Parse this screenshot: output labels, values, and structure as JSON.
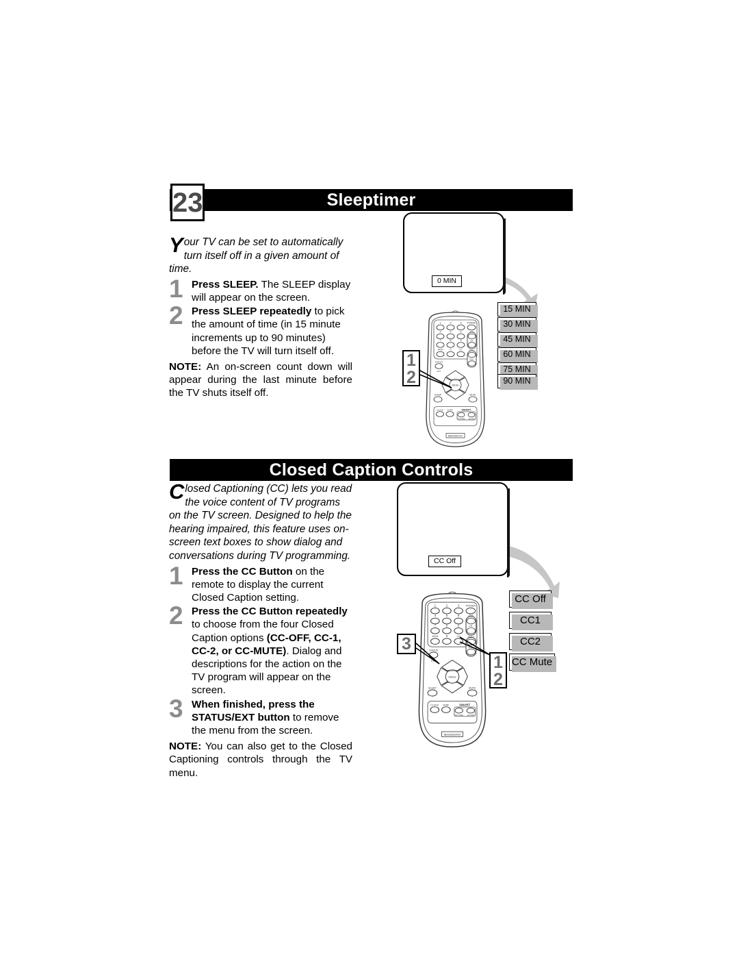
{
  "page": {
    "number": "23"
  },
  "sections": [
    {
      "id": "sleeptimer",
      "title": "Sleeptimer",
      "intro_dropcap": "Y",
      "intro_text": "our TV can be set to automatically turn itself off in a given amount of time.",
      "steps": [
        {
          "num": "1",
          "bold": "Press SLEEP.",
          "rest": " The SLEEP display will appear on the screen."
        },
        {
          "num": "2",
          "bold": "Press SLEEP repeatedly",
          "rest": " to pick the amount of time (in 15 minute increments up to 90 minutes) before the TV will turn itself off."
        }
      ],
      "note_label": "NOTE:",
      "note_text": " An on-screen count down will appear during the last minute before the TV shuts itself off.",
      "tv_osd": "0 MIN",
      "options": [
        "15 MIN",
        "30 MIN",
        "45 MIN",
        "60 MIN",
        "75 MIN",
        "90 MIN"
      ],
      "callout": [
        "1",
        "2"
      ]
    },
    {
      "id": "closed-caption-controls",
      "title": "Closed Caption Controls",
      "intro_dropcap": "C",
      "intro_text": "losed Captioning (CC) lets you read the voice content of TV programs on the TV screen. Designed to help the hearing impaired, this feature uses on-screen text boxes to show dialog and conversations during TV programming.",
      "steps": [
        {
          "num": "1",
          "bold": "Press the CC Button",
          "rest": " on the remote to display the current Closed Caption setting."
        },
        {
          "num": "2",
          "bold": "Press the CC Button repeatedly",
          "mid": " to choose from the four Closed Caption options ",
          "bold2": "(CC-OFF, CC-1, CC-2, or CC-MUTE)",
          "rest": ". Dialog and descriptions for the action on the TV program will appear on the screen."
        },
        {
          "num": "3",
          "bold": "When finished, press the STATUS/EXT button",
          "rest": " to remove the menu from the screen."
        }
      ],
      "note_label": "NOTE:",
      "note_text": " You can also get to the Closed Captioning controls through the TV menu.",
      "tv_osd": "CC Off",
      "options": [
        "CC Off",
        "CC1",
        "CC2",
        "CC Mute"
      ],
      "callout_left": "3",
      "callout_right": [
        "1",
        "2"
      ]
    }
  ],
  "remote": {
    "brand": "MAGNAVOX",
    "keypad": [
      "1",
      "2",
      "3",
      "4",
      "5",
      "6",
      "7",
      "8",
      "9",
      "A/CH",
      "0",
      "CC"
    ],
    "power": "POWER",
    "ch_up": "CH+",
    "ch_down": "CH-",
    "vol_up": "VOL+",
    "vol_down": "VOL-",
    "status": "STATUS",
    "ext": "EXT",
    "sleep": "SLEEP",
    "mute": "MUTE",
    "menu_top": "SELECT",
    "menu": "MENU",
    "clock": "CLOCK",
    "surf": "SURF",
    "smart": "SMART",
    "smart_picture": "PICTURE",
    "smart_sound": "SOUND"
  },
  "colors": {
    "bar_bg": "#000000",
    "bar_text": "#ffffff",
    "step_num": "#8c8c8c",
    "shadow": "#b8b8b8",
    "page_num_text": "#4a4a4a"
  }
}
